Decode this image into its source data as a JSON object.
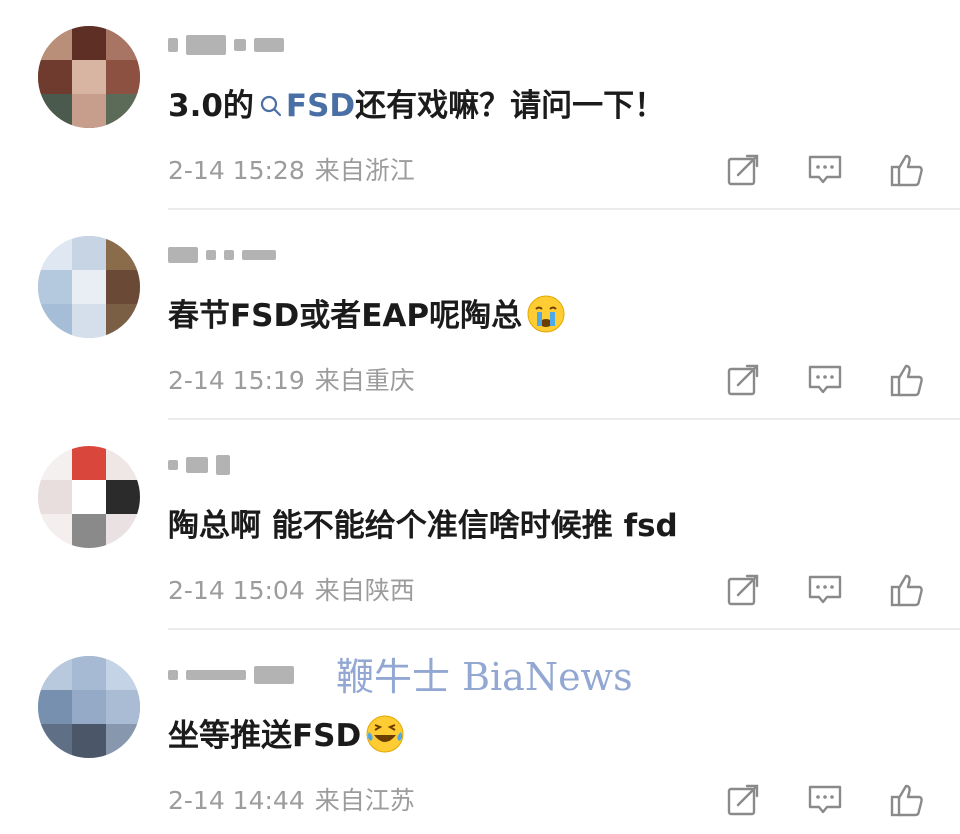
{
  "comments": [
    {
      "content_prefix": "3.0的",
      "link_text": "FSD",
      "content_suffix": "还有戏嘛？请问一下！",
      "date": "2-14 15:28",
      "location": "来自浙江",
      "emoji": ""
    },
    {
      "content": "春节FSD或者EAP呢陶总",
      "date": "2-14 15:19",
      "location": "来自重庆",
      "emoji": "crying-face"
    },
    {
      "content": "陶总啊 能不能给个准信啥时候推 fsd",
      "date": "2-14 15:04",
      "location": "来自陕西",
      "emoji": ""
    },
    {
      "content": "坐等推送FSD",
      "date": "2-14 14:44",
      "location": "来自江苏",
      "emoji": "laughing-tears-face"
    }
  ],
  "actions": [
    "share-icon",
    "comment-icon",
    "like-icon"
  ],
  "watermark": "鞭牛士 BiaNews",
  "colors": {
    "link": "#4a6fa5",
    "meta": "#9c9c9c",
    "divider": "#ececec",
    "watermark": "#7f98c9"
  }
}
